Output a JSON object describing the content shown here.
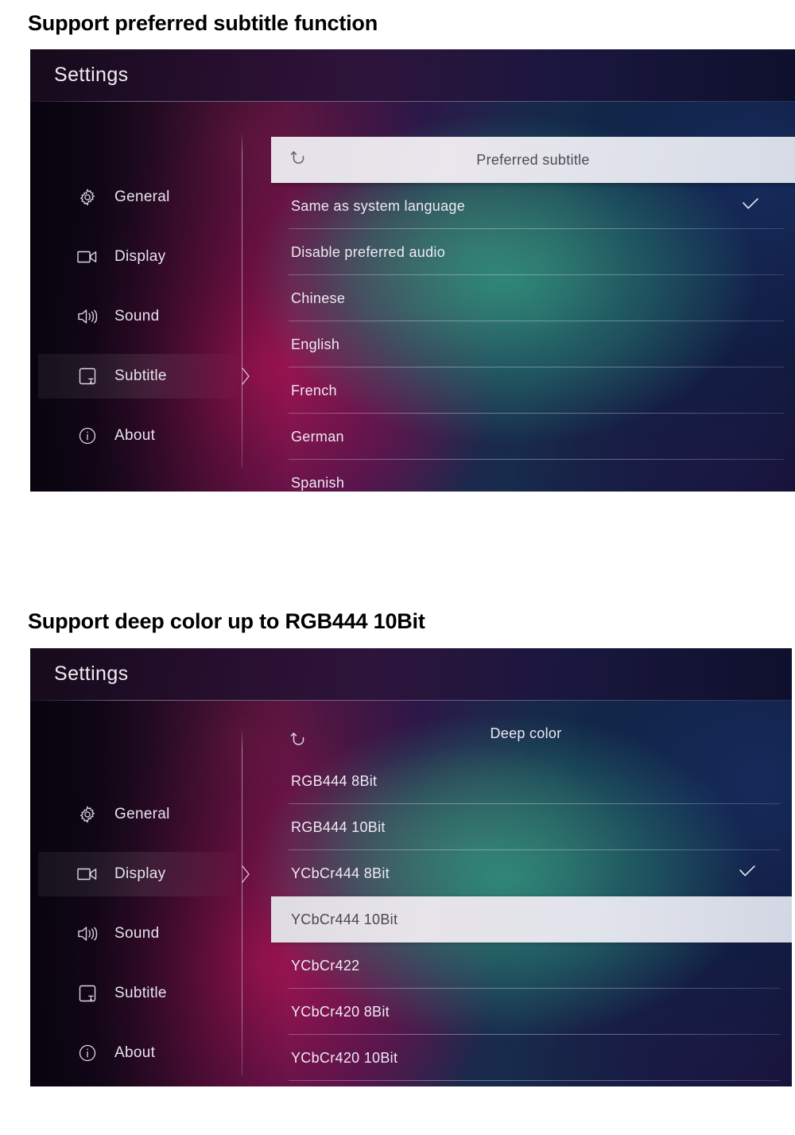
{
  "sections": [
    {
      "heading": "Support preferred subtitle function",
      "panel": {
        "titlebar": {
          "label": "Settings"
        },
        "sidebar": {
          "items": [
            {
              "label": "General",
              "icon": "gear-icon",
              "active": false
            },
            {
              "label": "Display",
              "icon": "video-icon",
              "active": false
            },
            {
              "label": "Sound",
              "icon": "speaker-icon",
              "active": false
            },
            {
              "label": "Subtitle",
              "icon": "subtitle-icon",
              "active": true
            },
            {
              "label": "About",
              "icon": "info-icon",
              "active": false
            }
          ]
        },
        "list": {
          "header_title": "Preferred subtitle",
          "back_icon": "back-arrow-icon",
          "header_style": "solid",
          "options": [
            {
              "label": "Same as system language",
              "checked": true
            },
            {
              "label": "Disable preferred audio",
              "checked": false
            },
            {
              "label": "Chinese",
              "checked": false
            },
            {
              "label": "English",
              "checked": false
            },
            {
              "label": "French",
              "checked": false
            },
            {
              "label": "German",
              "checked": false
            },
            {
              "label": "Spanish",
              "checked": false
            }
          ]
        }
      }
    },
    {
      "heading": "Support deep color up to RGB444 10Bit",
      "panel": {
        "titlebar": {
          "label": "Settings"
        },
        "sidebar": {
          "items": [
            {
              "label": "General",
              "icon": "gear-icon",
              "active": false
            },
            {
              "label": "Display",
              "icon": "video-icon",
              "active": true
            },
            {
              "label": "Sound",
              "icon": "speaker-icon",
              "active": false
            },
            {
              "label": "Subtitle",
              "icon": "subtitle-icon",
              "active": false
            },
            {
              "label": "About",
              "icon": "info-icon",
              "active": false
            }
          ]
        },
        "list": {
          "header_title": "Deep color",
          "back_icon": "back-arrow-icon",
          "header_style": "scrolled",
          "options": [
            {
              "label": "RGB444 8Bit",
              "checked": false,
              "highlighted": false
            },
            {
              "label": "RGB444 10Bit",
              "checked": false,
              "highlighted": false
            },
            {
              "label": "YCbCr444 8Bit",
              "checked": true,
              "highlighted": false
            },
            {
              "label": "YCbCr444 10Bit",
              "checked": false,
              "highlighted": true
            },
            {
              "label": "YCbCr422",
              "checked": false,
              "highlighted": false
            },
            {
              "label": "YCbCr420 8Bit",
              "checked": false,
              "highlighted": false
            },
            {
              "label": "YCbCr420 10Bit",
              "checked": false,
              "highlighted": false
            }
          ]
        }
      }
    }
  ],
  "colors": {
    "heading_text": "#000000",
    "panel_text": "#eee9f4",
    "selected_row_bg": "#e2e0e8",
    "selected_row_text": "#4a4652",
    "header_bar_bg": "#e6e1e8"
  }
}
